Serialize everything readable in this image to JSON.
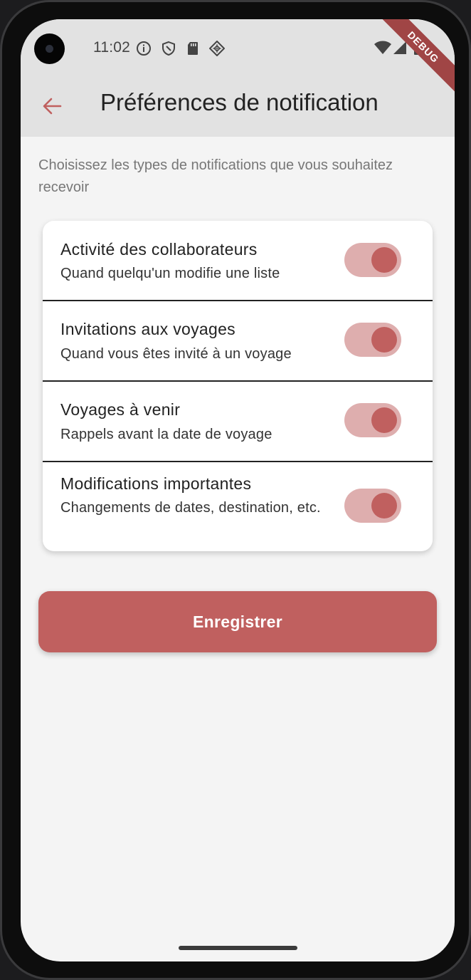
{
  "status_bar": {
    "time": "11:02",
    "icons": [
      "info-icon",
      "shield-icon",
      "sd-card-icon",
      "cast-icon",
      "wifi-icon",
      "signal-icon",
      "battery-icon"
    ]
  },
  "debug_banner": "DEBUG",
  "header": {
    "back_icon": "arrow-left-icon",
    "title": "Préférences de notification"
  },
  "intro": "Choisissez les types de notifications que vous souhaitez recevoir",
  "preferences": [
    {
      "title": "Activité des collaborateurs",
      "subtitle": "Quand quelqu'un modifie une liste",
      "enabled": true
    },
    {
      "title": "Invitations aux voyages",
      "subtitle": "Quand vous êtes invité à un voyage",
      "enabled": true
    },
    {
      "title": "Voyages à venir",
      "subtitle": "Rappels avant la date de voyage",
      "enabled": true
    },
    {
      "title": "Modifications importantes",
      "subtitle": "Changements de dates, destination, etc.",
      "enabled": true
    }
  ],
  "save_label": "Enregistrer",
  "colors": {
    "accent": "#c0605f",
    "toggle_track": "#deaeae",
    "app_bar": "#e2e2e2",
    "background": "#f4f4f4"
  }
}
